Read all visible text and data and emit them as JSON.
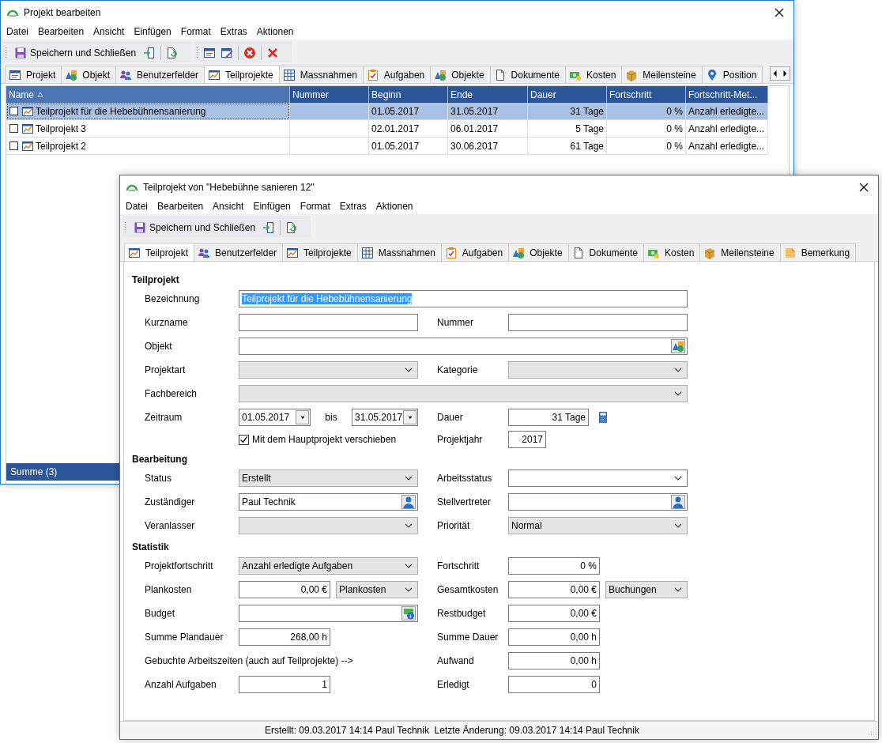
{
  "main_window": {
    "title": "Projekt bearbeiten",
    "menu": [
      "Datei",
      "Bearbeiten",
      "Ansicht",
      "Einfügen",
      "Format",
      "Extras",
      "Aktionen"
    ],
    "save_label": "Speichern und Schließen",
    "tabs": [
      {
        "label": "Projekt",
        "selected": false
      },
      {
        "label": "Objekt",
        "selected": false
      },
      {
        "label": "Benutzerfelder",
        "selected": false
      },
      {
        "label": "Teilprojekte",
        "selected": true
      },
      {
        "label": "Massnahmen",
        "selected": false
      },
      {
        "label": "Aufgaben",
        "selected": false
      },
      {
        "label": "Objekte",
        "selected": false
      },
      {
        "label": "Dokumente",
        "selected": false
      },
      {
        "label": "Kosten",
        "selected": false
      },
      {
        "label": "Meilensteine",
        "selected": false
      },
      {
        "label": "Position",
        "selected": false
      }
    ],
    "table": {
      "columns": [
        {
          "label": "Name",
          "sorted": true
        },
        {
          "label": "Nummer",
          "sorted": false
        },
        {
          "label": "Beginn",
          "sorted": false
        },
        {
          "label": "Ende",
          "sorted": false
        },
        {
          "label": "Dauer",
          "sorted": false
        },
        {
          "label": "Fortschritt",
          "sorted": false
        },
        {
          "label": "Fortschritt-Met...",
          "sorted": false
        }
      ],
      "rows": [
        {
          "checked": false,
          "selected": true,
          "name": "Teilprojekt für die Hebebühnensanierung",
          "start": "01.05.2017",
          "end": "31.05.2017",
          "duration": "31 Tage",
          "progress": "0 %",
          "progress_method": "Anzahl erledigte..."
        },
        {
          "checked": false,
          "selected": false,
          "name": "Teilprojekt 3",
          "start": "02.01.2017",
          "end": "06.01.2017",
          "duration": "5 Tage",
          "progress": "0 %",
          "progress_method": "Anzahl erledigte..."
        },
        {
          "checked": false,
          "selected": false,
          "name": "Teilprojekt 2",
          "start": "01.05.2017",
          "end": "30.06.2017",
          "duration": "61 Tage",
          "progress": "0 %",
          "progress_method": "Anzahl erledigte..."
        }
      ],
      "footer": "Summe (3)"
    }
  },
  "dialog": {
    "title": "Teilprojekt von \"Hebebühne sanieren 12\"",
    "menu": [
      "Datei",
      "Bearbeiten",
      "Ansicht",
      "Einfügen",
      "Format",
      "Extras",
      "Aktionen"
    ],
    "save_label": "Speichern und Schließen",
    "tabs": [
      {
        "label": "Teilprojekt",
        "selected": true
      },
      {
        "label": "Benutzerfelder",
        "selected": false
      },
      {
        "label": "Teilprojekte",
        "selected": false
      },
      {
        "label": "Massnahmen",
        "selected": false
      },
      {
        "label": "Aufgaben",
        "selected": false
      },
      {
        "label": "Objekte",
        "selected": false
      },
      {
        "label": "Dokumente",
        "selected": false
      },
      {
        "label": "Kosten",
        "selected": false
      },
      {
        "label": "Meilensteine",
        "selected": false
      },
      {
        "label": "Bemerkung",
        "selected": false
      }
    ],
    "sections": [
      {
        "title": "Teilprojekt",
        "rows": [
          {
            "left": {
              "kind": "wide-text",
              "label": "Bezeichnung",
              "value": "Teilprojekt für die Hebebühnensanierung",
              "highlighted": true
            }
          },
          {
            "left": {
              "kind": "text",
              "label": "Kurzname"
            },
            "right": {
              "kind": "text",
              "label": "Nummer"
            }
          },
          {
            "left": {
              "kind": "wide-picker",
              "label": "Objekt"
            }
          },
          {
            "left": {
              "kind": "list",
              "label": "Projektart"
            },
            "right": {
              "kind": "list",
              "label": "Kategorie"
            }
          },
          {
            "left": {
              "kind": "wide-list",
              "label": "Fachbereich"
            }
          },
          {
            "left": {
              "kind": "dates",
              "label": "Zeitraum",
              "from": "01.05.2017",
              "separator": "bis",
              "to": "31.05.2017"
            },
            "right": {
              "kind": "duration",
              "label": "Dauer",
              "value": "31 Tage"
            }
          },
          {
            "left": {
              "kind": "checkbox",
              "text": "Mit dem Hauptprojekt verschieben",
              "checked": true
            },
            "right": {
              "kind": "year",
              "label": "Projektjahr",
              "value": "2017"
            }
          }
        ]
      },
      {
        "title": "Bearbeitung",
        "rows": [
          {
            "left": {
              "kind": "list",
              "label": "Status",
              "value": "Erstellt"
            },
            "right": {
              "kind": "combo",
              "label": "Arbeitsstatus"
            }
          },
          {
            "left": {
              "kind": "person",
              "label": "Zuständiger",
              "value": "Paul Technik"
            },
            "right": {
              "kind": "person",
              "label": "Stellvertreter"
            }
          },
          {
            "left": {
              "kind": "list",
              "label": "Veranlasser"
            },
            "right": {
              "kind": "list",
              "label": "Priorität",
              "value": "Normal"
            }
          }
        ]
      },
      {
        "title": "Statistik",
        "rows": [
          {
            "left": {
              "kind": "list",
              "label": "Projektfortschritt",
              "value": "Anzahl erledigte Aufgaben"
            },
            "right": {
              "kind": "number",
              "label": "Fortschritt",
              "value": "0 %"
            }
          },
          {
            "left": {
              "kind": "number-list",
              "label": "Plankosten",
              "value": "0,00 €",
              "option": "Plankosten"
            },
            "right": {
              "kind": "number-list",
              "label": "Gesamtkosten",
              "value": "0,00 €",
              "option": "Buchungen"
            }
          },
          {
            "left": {
              "kind": "budget",
              "label": "Budget"
            },
            "right": {
              "kind": "number",
              "label": "Restbudget",
              "value": "0,00 €"
            }
          },
          {
            "left": {
              "kind": "number",
              "label": "Summe Plandauer",
              "value": "268,00 h"
            },
            "right": {
              "kind": "number",
              "label": "Summe Dauer",
              "value": "0,00 h"
            }
          },
          {
            "left": {
              "kind": "note",
              "label": "Gebuchte Arbeitszeiten (auch auf Teilprojekte) -->"
            },
            "right": {
              "kind": "number",
              "label": "Aufwand",
              "value": "0,00 h"
            }
          },
          {
            "left": {
              "kind": "number",
              "label": "Anzahl Aufgaben",
              "value": "1"
            },
            "right": {
              "kind": "number",
              "label": "Erledigt",
              "value": "0"
            }
          }
        ]
      }
    ],
    "status_bar": "Erstellt: 09.03.2017 14:14 Paul Technik  Letzte Änderung: 09.03.2017 14:14 Paul Technik"
  }
}
